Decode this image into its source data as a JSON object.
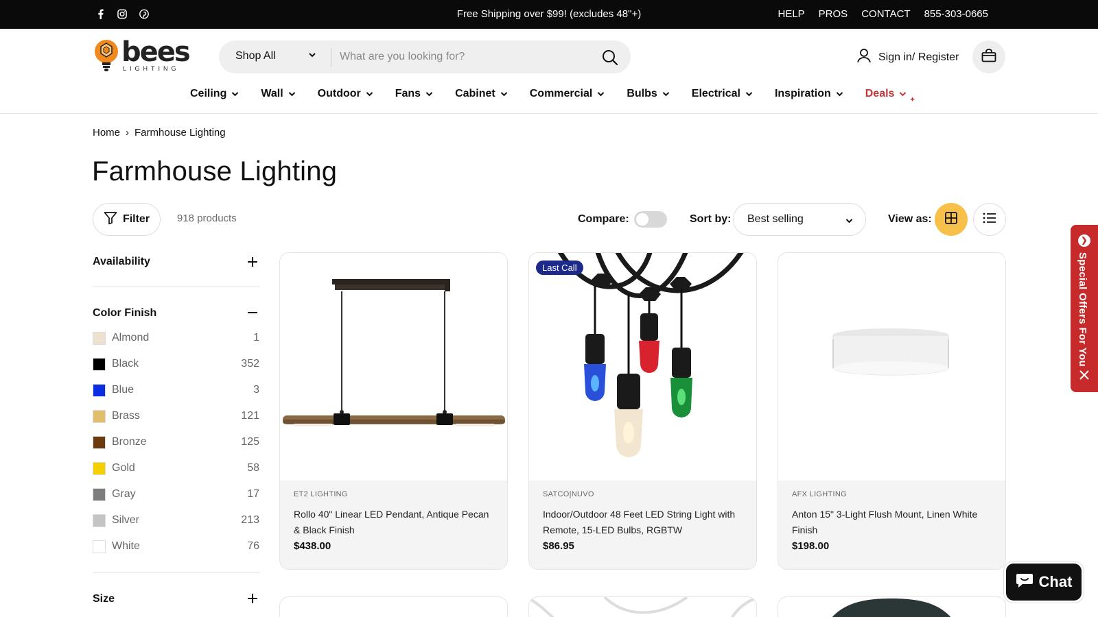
{
  "topbar": {
    "announcement": "Free Shipping over $99! (excludes 48\"+)",
    "links": [
      "HELP",
      "PROS",
      "CONTACT",
      "855-303-0665"
    ],
    "social_icons": [
      "facebook-icon",
      "instagram-icon",
      "pinterest-icon"
    ]
  },
  "logo": {
    "brand": "bees",
    "sub": "LIGHTING"
  },
  "search": {
    "department": "Shop All",
    "placeholder": "What are you looking for?"
  },
  "account": {
    "label": "Sign in/ Register"
  },
  "nav": {
    "items": [
      "Ceiling",
      "Wall",
      "Outdoor",
      "Fans",
      "Cabinet",
      "Commercial",
      "Bulbs",
      "Electrical",
      "Inspiration",
      "Deals"
    ]
  },
  "breadcrumb": {
    "home": "Home",
    "current": "Farmhouse Lighting"
  },
  "page": {
    "title": "Farmhouse Lighting"
  },
  "toolbar": {
    "filter_label": "Filter",
    "product_count": "918 products",
    "compare_label": "Compare:",
    "compare_on": false,
    "sort_label": "Sort by:",
    "sort_value": "Best selling",
    "view_label": "View as:",
    "view_active": "grid"
  },
  "filters": {
    "availability": "Availability",
    "color_finish": "Color Finish",
    "size": "Size",
    "colors": [
      {
        "name": "Almond",
        "count": "1",
        "hex": "#efe1cf"
      },
      {
        "name": "Black",
        "count": "352",
        "hex": "#000000"
      },
      {
        "name": "Blue",
        "count": "3",
        "hex": "#0a2de3"
      },
      {
        "name": "Brass",
        "count": "121",
        "hex": "#e0be6b"
      },
      {
        "name": "Bronze",
        "count": "125",
        "hex": "#6b3a0e"
      },
      {
        "name": "Gold",
        "count": "58",
        "hex": "#f5d000"
      },
      {
        "name": "Gray",
        "count": "17",
        "hex": "#7d7d7d"
      },
      {
        "name": "Silver",
        "count": "213",
        "hex": "#c4c4c4"
      },
      {
        "name": "White",
        "count": "76",
        "hex": "#ffffff"
      }
    ]
  },
  "products": [
    {
      "vendor": "ET2 LIGHTING",
      "title": "Rollo 40\" Linear LED Pendant, Antique Pecan & Black Finish",
      "price": "$438.00",
      "badge": ""
    },
    {
      "vendor": "SATCO|NUVO",
      "title": "Indoor/Outdoor 48 Feet LED String Light with Remote, 15-LED Bulbs, RGBTW",
      "price": "$86.95",
      "badge": "Last Call"
    },
    {
      "vendor": "AFX LIGHTING",
      "title": "Anton 15\" 3-Light Flush Mount, Linen White Finish",
      "price": "$198.00",
      "badge": ""
    }
  ],
  "offers_tab": {
    "label": "Special Offers For You"
  },
  "chat": {
    "label": "Chat"
  },
  "colors": {
    "accent": "#f6c04b",
    "deals": "#c8343a",
    "badge": "#1e2a8a",
    "offers": "#c62a2a"
  }
}
